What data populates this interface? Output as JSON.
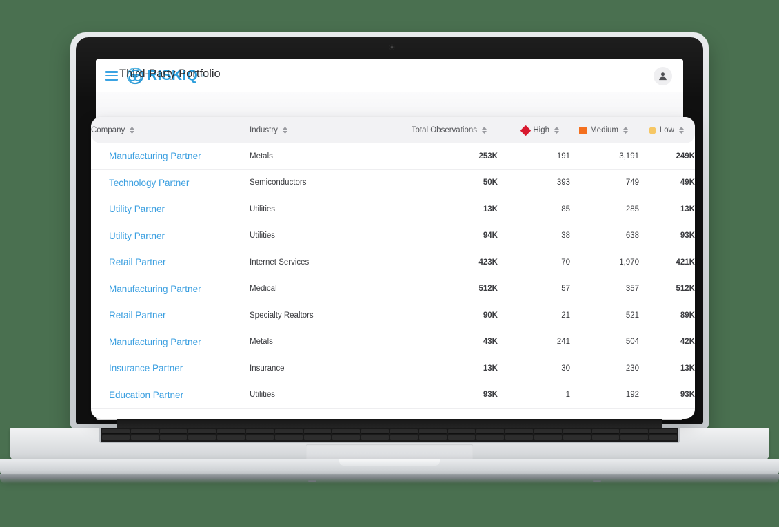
{
  "background_color": "#4a7050",
  "device": {
    "type": "laptop-mockup",
    "webcam": "webcam-dot"
  },
  "app": {
    "brand": {
      "name": "RISKIQ",
      "trademark": "®",
      "logo_icon": "riskiq-knot-logo",
      "color": "#2b9ddb"
    },
    "menu_icon": "hamburger-menu-icon",
    "avatar_icon": "user-avatar-icon",
    "page_title": "Third-Party Portfolio"
  },
  "table": {
    "sort_icon": "sort-arrows-icon",
    "columns": [
      {
        "key": "company",
        "label": "Company",
        "align": "left",
        "icon": null,
        "icon_color": null
      },
      {
        "key": "industry",
        "label": "Industry",
        "align": "left",
        "icon": null,
        "icon_color": null
      },
      {
        "key": "total",
        "label": "Total Observations",
        "align": "right",
        "icon": null,
        "icon_color": null
      },
      {
        "key": "high",
        "label": "High",
        "align": "right",
        "icon": "severity-high-diamond-icon",
        "icon_color": "#d8192f"
      },
      {
        "key": "medium",
        "label": "Medium",
        "align": "right",
        "icon": "severity-medium-square-icon",
        "icon_color": "#f4701f"
      },
      {
        "key": "low",
        "label": "Low",
        "align": "right",
        "icon": "severity-low-circle-icon",
        "icon_color": "#f6c765"
      }
    ],
    "rows": [
      {
        "company": "Manufacturing Partner",
        "industry": "Metals",
        "total": "253K",
        "high": "191",
        "medium": "3,191",
        "low": "249K"
      },
      {
        "company": "Technology Partner",
        "industry": "Semiconductors",
        "total": "50K",
        "high": "393",
        "medium": "749",
        "low": "49K"
      },
      {
        "company": "Utility Partner",
        "industry": "Utilities",
        "total": "13K",
        "high": "85",
        "medium": "285",
        "low": "13K"
      },
      {
        "company": "Utility Partner",
        "industry": "Utilities",
        "total": "94K",
        "high": "38",
        "medium": "638",
        "low": "93K"
      },
      {
        "company": "Retail Partner",
        "industry": "Internet Services",
        "total": "423K",
        "high": "70",
        "medium": "1,970",
        "low": "421K"
      },
      {
        "company": "Manufacturing Partner",
        "industry": "Medical",
        "total": "512K",
        "high": "57",
        "medium": "357",
        "low": "512K"
      },
      {
        "company": "Retail Partner",
        "industry": "Specialty Realtors",
        "total": "90K",
        "high": "21",
        "medium": "521",
        "low": "89K"
      },
      {
        "company": "Manufacturing Partner",
        "industry": "Metals",
        "total": "43K",
        "high": "241",
        "medium": "504",
        "low": "42K"
      },
      {
        "company": "Insurance Partner",
        "industry": "Insurance",
        "total": "13K",
        "high": "30",
        "medium": "230",
        "low": "13K"
      },
      {
        "company": "Education Partner",
        "industry": "Utilities",
        "total": "93K",
        "high": "1",
        "medium": "192",
        "low": "93K"
      }
    ]
  }
}
